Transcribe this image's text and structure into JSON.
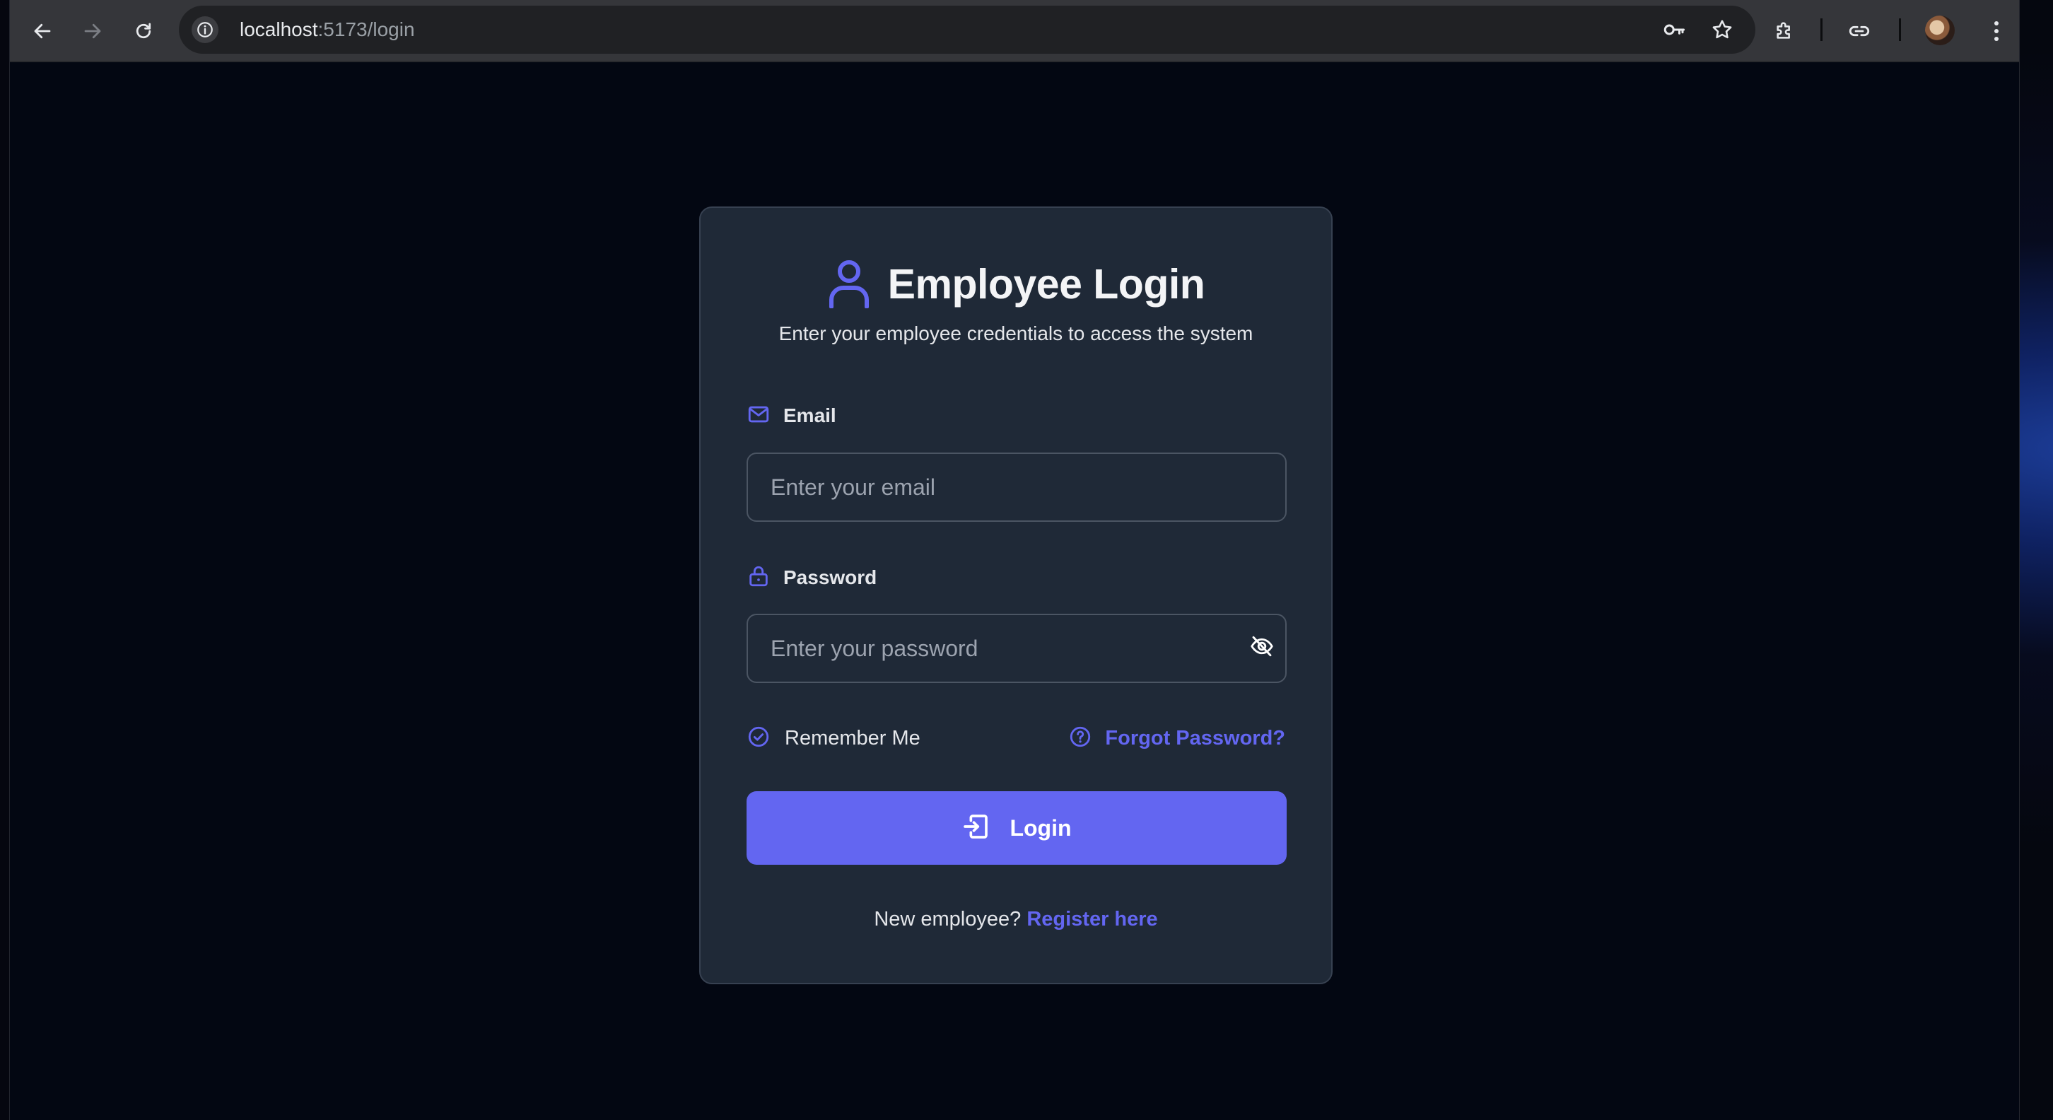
{
  "browser": {
    "url_host": "localhost",
    "url_path": ":5173/login",
    "icons": [
      "back-arrow-icon",
      "forward-arrow-icon",
      "reload-icon",
      "info-icon",
      "key-icon",
      "star-icon",
      "extensions-icon",
      "link-icon",
      "profile-avatar",
      "more-vert-icon"
    ]
  },
  "login": {
    "title": "Employee Login",
    "subtitle": "Enter your employee credentials to access the system",
    "email": {
      "label": "Email",
      "placeholder": "Enter your email",
      "value": ""
    },
    "password": {
      "label": "Password",
      "placeholder": "Enter your password",
      "value": ""
    },
    "remember_label": "Remember Me",
    "forgot_label": "Forgot Password?",
    "submit_label": "Login",
    "footer_prompt": "New employee?",
    "footer_link": "Register here"
  },
  "colors": {
    "accent": "#6366f1",
    "card_bg": "#1f2937",
    "page_bg": "#030712",
    "text": "#e5e7eb"
  }
}
